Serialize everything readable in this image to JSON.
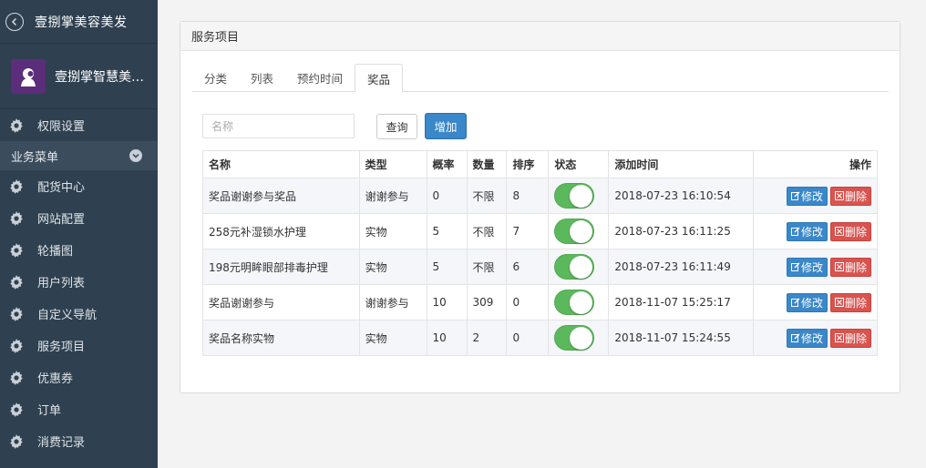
{
  "sidebar": {
    "back_title": "壹捌掌美容美发",
    "profile_name": "壹捌掌智慧美容...",
    "top_item": {
      "label": "权限设置",
      "icon": "gear-icon"
    },
    "section": {
      "label": "业务菜单"
    },
    "items": [
      {
        "label": "配货中心",
        "icon": "gear-icon"
      },
      {
        "label": "网站配置",
        "icon": "gear-icon"
      },
      {
        "label": "轮播图",
        "icon": "gear-icon"
      },
      {
        "label": "用户列表",
        "icon": "gear-icon"
      },
      {
        "label": "自定义导航",
        "icon": "gear-icon"
      },
      {
        "label": "服务项目",
        "icon": "gear-icon"
      },
      {
        "label": "优惠券",
        "icon": "gear-icon"
      },
      {
        "label": "订单",
        "icon": "gear-icon"
      },
      {
        "label": "消费记录",
        "icon": "gear-icon"
      }
    ]
  },
  "panel": {
    "title": "服务项目",
    "tabs": [
      {
        "label": "分类",
        "active": false
      },
      {
        "label": "列表",
        "active": false
      },
      {
        "label": "预约时间",
        "active": false
      },
      {
        "label": "奖品",
        "active": true
      }
    ]
  },
  "search": {
    "placeholder": "名称",
    "value": ""
  },
  "buttons": {
    "query": "查询",
    "add": "增加"
  },
  "table": {
    "headers": {
      "name": "名称",
      "type": "类型",
      "rate": "概率",
      "qty": "数量",
      "sort": "排序",
      "status": "状态",
      "time": "添加时间",
      "ops": "操作"
    },
    "edit_label": "修改",
    "delete_label": "删除",
    "rows": [
      {
        "name": "奖品谢谢参与奖品",
        "type": "谢谢参与",
        "rate": "0",
        "qty": "不限",
        "sort": "8",
        "status": true,
        "time": "2018-07-23 16:10:54"
      },
      {
        "name": "258元补湿锁水护理",
        "type": "实物",
        "rate": "5",
        "qty": "不限",
        "sort": "7",
        "status": true,
        "time": "2018-07-23 16:11:25"
      },
      {
        "name": "198元明眸眼部排毒护理",
        "type": "实物",
        "rate": "5",
        "qty": "不限",
        "sort": "6",
        "status": true,
        "time": "2018-07-23 16:11:49"
      },
      {
        "name": "奖品谢谢参与",
        "type": "谢谢参与",
        "rate": "10",
        "qty": "309",
        "sort": "0",
        "status": true,
        "time": "2018-11-07 15:25:17"
      },
      {
        "name": "奖品名称实物",
        "type": "实物",
        "rate": "10",
        "qty": "2",
        "sort": "0",
        "status": true,
        "time": "2018-11-07 15:24:55"
      }
    ]
  },
  "colors": {
    "sidebar_bg": "#2f4050",
    "primary": "#3a87c9",
    "danger": "#d9534f",
    "toggle_on": "#5cb85c"
  }
}
